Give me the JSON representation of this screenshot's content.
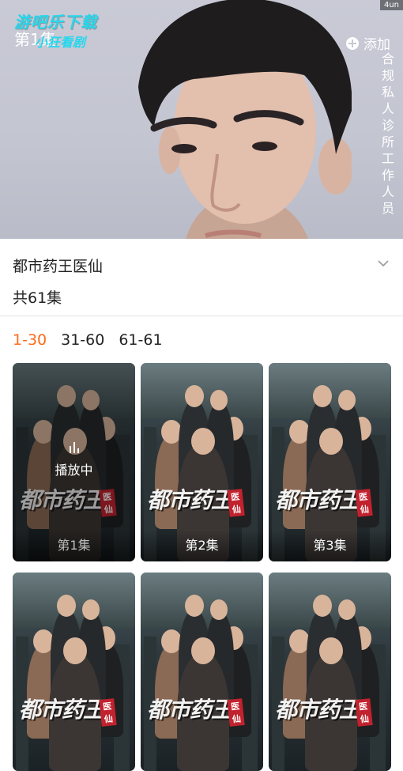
{
  "video": {
    "watermark_top": "游吧乐下载",
    "watermark_sub": "小狂看剧",
    "episode_overlay": "第1集",
    "corner_tag": "4un",
    "add_label": "添加",
    "vertical_text": "合规私人诊所工作人员"
  },
  "drama": {
    "title": "都市药王医仙",
    "episode_count": "共61集"
  },
  "tabs": [
    {
      "label": "1-30",
      "active": true
    },
    {
      "label": "31-60",
      "active": false
    },
    {
      "label": "61-61",
      "active": false
    }
  ],
  "poster": {
    "logo_main": "都市药王",
    "logo_tag": "医仙"
  },
  "episodes": [
    {
      "label": "第1集",
      "playing": true,
      "playing_text": "播放中"
    },
    {
      "label": "第2集",
      "playing": false
    },
    {
      "label": "第3集",
      "playing": false
    },
    {
      "label": "",
      "playing": false
    },
    {
      "label": "",
      "playing": false
    },
    {
      "label": "",
      "playing": false
    }
  ],
  "colors": {
    "accent": "#ff6b1a",
    "watermark": "#26d7ec"
  }
}
